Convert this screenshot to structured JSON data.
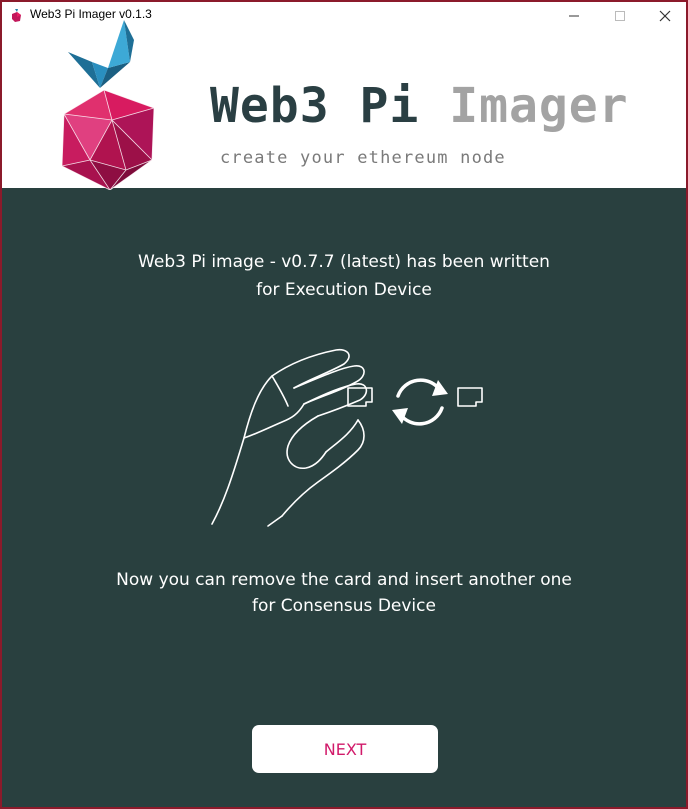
{
  "window": {
    "title": "Web3 Pi Imager v0.1.3",
    "controls": {
      "minimize": "—",
      "maximize": "☐",
      "close": "✕"
    }
  },
  "header": {
    "title_part1": "Web3 Pi ",
    "title_part2": "Imager",
    "subtitle": "create your ethereum node",
    "logo_icon": "raspberry-cube-logo"
  },
  "main": {
    "written_line1": "Web3 Pi image - v0.7.7 (latest) has been written",
    "written_line2": "for Execution Device",
    "illustration_icon": "hand-swap-sd-card-icon",
    "instruction_line1": "Now you can remove the card and insert another one",
    "instruction_line2": "for Consensus Device",
    "next_label": "NEXT"
  },
  "colors": {
    "background": "#29403f",
    "accent": "#d11a6a",
    "brand_dark": "#2a3f43",
    "brand_gray": "#a3a3a3",
    "window_border": "#8b1a2b"
  }
}
